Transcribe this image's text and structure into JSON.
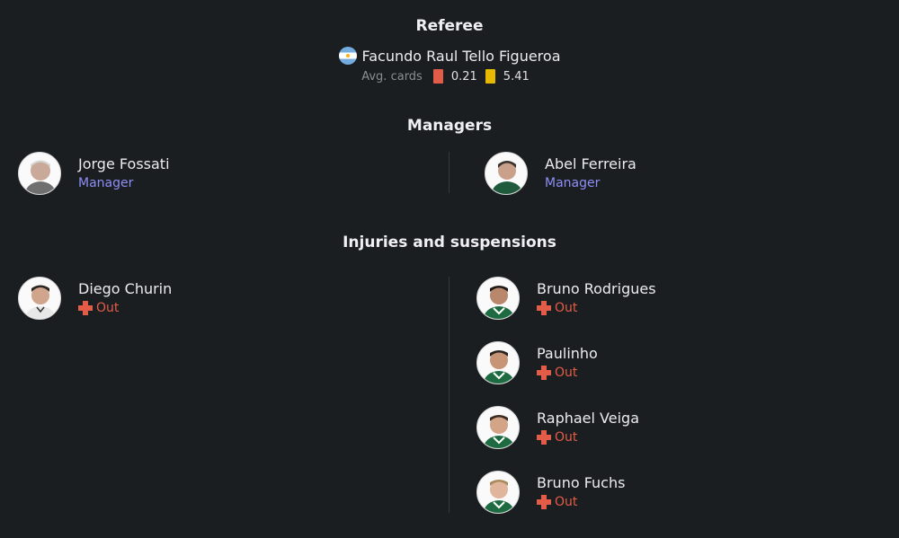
{
  "referee": {
    "section_title": "Referee",
    "name": "Facundo Raul Tello Figueroa",
    "flag_icon": "argentina-flag-icon",
    "avg_cards_label": "Avg. cards",
    "red_avg": "0.21",
    "yellow_avg": "5.41",
    "red_color": "#e35c47",
    "yellow_color": "#e6b800"
  },
  "managers": {
    "section_title": "Managers",
    "home": {
      "name": "Jorge Fossati",
      "role": "Manager"
    },
    "away": {
      "name": "Abel Ferreira",
      "role": "Manager"
    }
  },
  "injuries": {
    "section_title": "Injuries and suspensions",
    "home": [
      {
        "name": "Diego Churin",
        "status": "Out"
      }
    ],
    "away": [
      {
        "name": "Bruno Rodrigues",
        "status": "Out"
      },
      {
        "name": "Paulinho",
        "status": "Out"
      },
      {
        "name": "Raphael Veiga",
        "status": "Out"
      },
      {
        "name": "Bruno Fuchs",
        "status": "Out"
      }
    ],
    "status_color": "#e35c47",
    "role_color": "#8c8ff5"
  }
}
